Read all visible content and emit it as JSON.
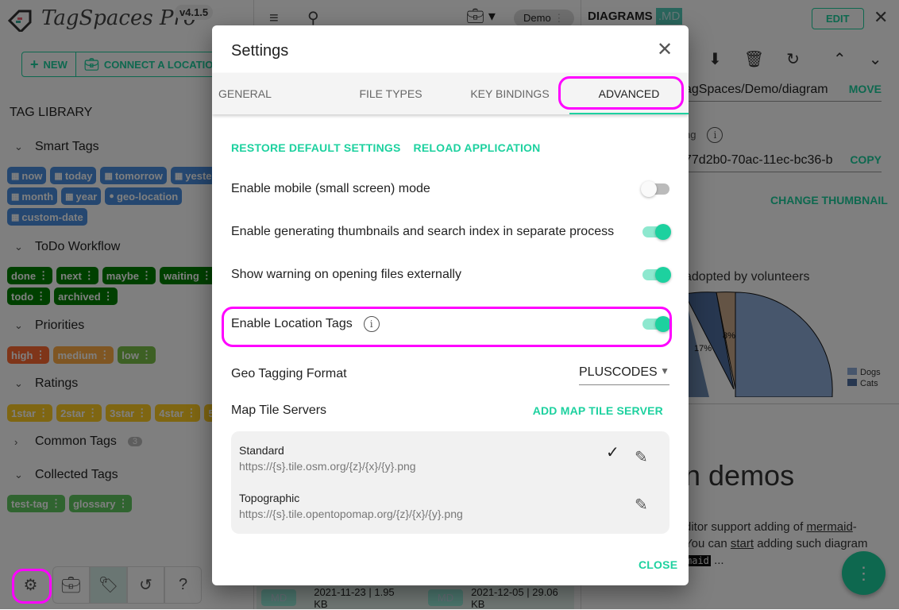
{
  "app": {
    "name": "TagSpaces Pro",
    "version": "v4.1.5"
  },
  "sidebar": {
    "new_label": "NEW",
    "connect_label": "CONNECT A LOCATION",
    "tag_library": "TAG LIBRARY",
    "groups": [
      {
        "name": "Smart Tags",
        "expanded": true,
        "color": "#4a8fe0",
        "tags": [
          {
            "label": "now",
            "icon": "calendar-icon"
          },
          {
            "label": "today",
            "icon": "calendar-icon"
          },
          {
            "label": "tomorrow",
            "icon": "calendar-icon"
          },
          {
            "label": "yesterday",
            "icon": "calendar-icon"
          },
          {
            "label": "month",
            "icon": "calendar-icon"
          },
          {
            "label": "year",
            "icon": "calendar-icon"
          },
          {
            "label": "geo-location",
            "icon": "location-pin-icon"
          },
          {
            "label": "custom-date",
            "icon": "calendar-icon"
          }
        ]
      },
      {
        "name": "ToDo Workflow",
        "expanded": true,
        "color": "#008000",
        "tags": [
          {
            "label": "done"
          },
          {
            "label": "next"
          },
          {
            "label": "maybe"
          },
          {
            "label": "waiting"
          },
          {
            "label": "todo"
          },
          {
            "label": "archived"
          }
        ]
      },
      {
        "name": "Priorities",
        "expanded": true,
        "tags": [
          {
            "label": "high",
            "color": "#ff6a33"
          },
          {
            "label": "medium",
            "color": "#ffad46"
          },
          {
            "label": "low",
            "color": "#7bc148"
          }
        ]
      },
      {
        "name": "Ratings",
        "expanded": true,
        "color": "#ffcc24",
        "tags": [
          {
            "label": "1star"
          },
          {
            "label": "2star"
          },
          {
            "label": "3star"
          },
          {
            "label": "4star"
          },
          {
            "label": "5star"
          }
        ]
      },
      {
        "name": "Common Tags",
        "expanded": false,
        "count": "3"
      },
      {
        "name": "Collected Tags",
        "expanded": true,
        "color": "#61c861",
        "tags": [
          {
            "label": "test-tag"
          },
          {
            "label": "glossary"
          }
        ]
      }
    ],
    "bottom_icons": [
      "gear-icon",
      "briefcase-icon",
      "tag-icon",
      "history-icon",
      "help-icon"
    ]
  },
  "middle": {
    "location": "Demo",
    "files": [
      {
        "ext": "MD",
        "info": "2021-11-23 | 1.95 KB"
      },
      {
        "ext": "MD",
        "info": "2021-12-05 | 29.06 KB"
      }
    ]
  },
  "right": {
    "title": "DIAGRAMS",
    "ext": ".MD",
    "edit": "EDIT",
    "path": "agSpaces/Demo/diagram",
    "move": "MOVE",
    "id_label": "ng",
    "id_value": "77d2b0-70ac-11ec-bc36-b",
    "copy": "COPY",
    "change_thumbnail": "CHANGE THUMBNAIL",
    "chart_title": "adopted by volunteers",
    "pie_labels": [
      "17%",
      "8%"
    ],
    "legend": [
      "Dogs",
      "Cats"
    ],
    "heading": "n demos",
    "para1": "ditor support adding of ",
    "link1": "mermaid",
    "para1b": "-",
    "para2a": " You can ",
    "link2": "start",
    "para2b": " adding such diagram",
    "code": "maid",
    "para3": " ..."
  },
  "dialog": {
    "title": "Settings",
    "tabs": [
      "GENERAL",
      "FILE TYPES",
      "KEY BINDINGS",
      "ADVANCED"
    ],
    "active_tab": "ADVANCED",
    "restore": "RESTORE DEFAULT SETTINGS",
    "reload": "RELOAD APPLICATION",
    "settings": [
      {
        "label": "Enable mobile (small screen) mode",
        "on": false
      },
      {
        "label": "Enable generating thumbnails and search index in separate process",
        "on": true
      },
      {
        "label": "Show warning on opening files externally",
        "on": true
      },
      {
        "label": "Enable Location Tags",
        "on": true
      }
    ],
    "geo_label": "Geo Tagging Format",
    "geo_value": "PLUSCODES",
    "tile_label": "Map Tile Servers",
    "add_tile": "ADD MAP TILE SERVER",
    "servers": [
      {
        "name": "Standard",
        "url": "https://{s}.tile.osm.org/{z}/{x}/{y}.png",
        "default": true
      },
      {
        "name": "Topographic",
        "url": "https://{s}.tile.opentopomap.org/{z}/{x}/{y}.png",
        "default": false
      }
    ],
    "close": "CLOSE"
  },
  "colors": {
    "accent": "#1dd19f",
    "highlight": "#ff00ff"
  }
}
